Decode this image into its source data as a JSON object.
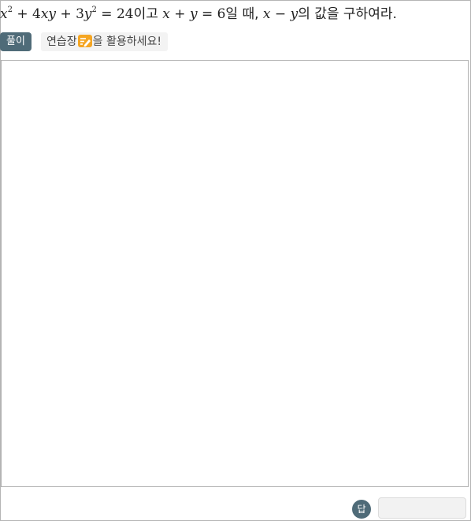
{
  "question": {
    "term1": "x",
    "exp1": "2",
    "plus1": " + 4",
    "term2": "xy",
    "plus2": " + 3",
    "term3": "y",
    "exp2": "2",
    "eq1": " = 24",
    "word1": "이고 ",
    "term4": "x",
    "plus3": " + ",
    "term5": "y",
    "eq2": " = 6",
    "word2": "일 때, ",
    "term6": "x",
    "minus": " − ",
    "term7": "y",
    "word3": "의 값을 구하여라."
  },
  "toolbar": {
    "solution_label": "풀이",
    "hint_before": "연습장",
    "hint_after": "을 활용하세요!",
    "pencil_color": "#f5a623"
  },
  "answer": {
    "icon_label": "답",
    "value": "",
    "placeholder": ""
  }
}
